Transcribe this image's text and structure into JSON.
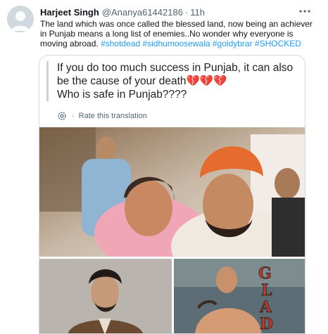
{
  "tweet": {
    "author_name": "Harjeet Singh",
    "author_handle": "@Ananya61442186",
    "separator": "·",
    "time": "11h",
    "text_prefix": "The land which was once called the blessed land, now being an achiever in Punjab means a long list of enemies..No wonder why everyone is moving abroad.",
    "hashtags": [
      "#shotdead",
      "#sidhumoosewala",
      "#goldybrar",
      "#SHOCKED"
    ]
  },
  "card": {
    "quote_line1": "If you do too much success in Punjab, it can also be the cause of your death",
    "quote_emoji": "💔💔💔",
    "quote_line2": "Who is safe in Punjab????",
    "translate_label": "Rate this translation"
  },
  "icons": {
    "more": "more-horizontal-icon",
    "translate": "gear-icon"
  },
  "colors": {
    "link": "#1d9bf0",
    "secondary_text": "#536471",
    "border": "#cfd9de"
  }
}
